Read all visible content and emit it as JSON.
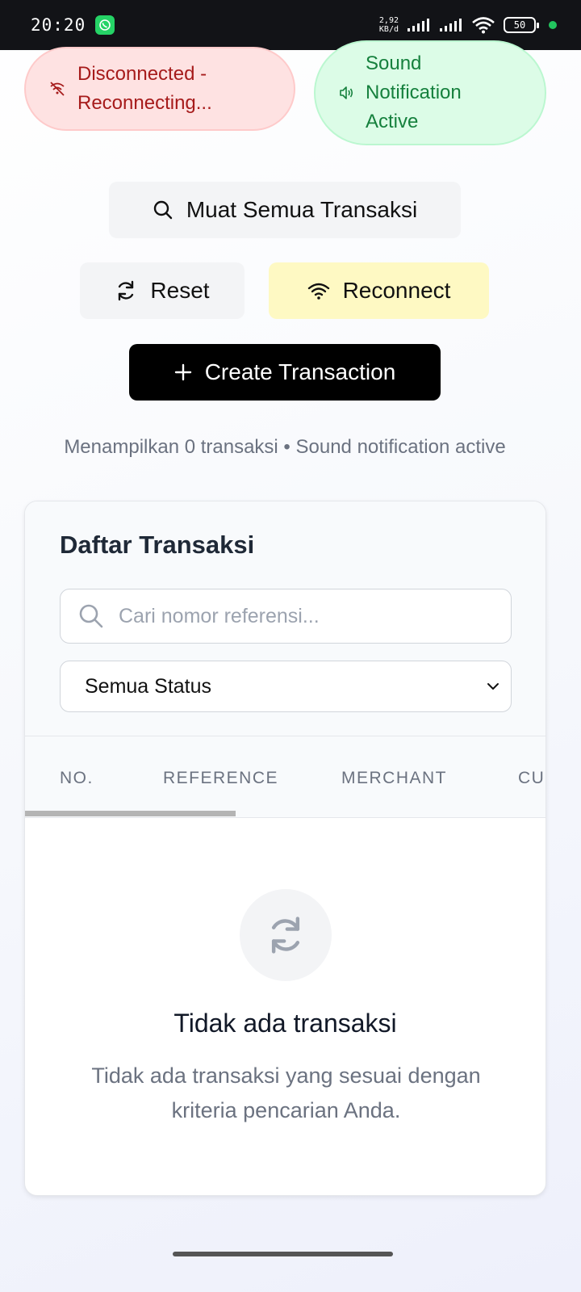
{
  "status_bar": {
    "time": "20:20",
    "net_speed_value": "2,92",
    "net_speed_unit": "KB/d",
    "battery": "50"
  },
  "connection": {
    "label": "Disconnected -\nReconnecting..."
  },
  "sound": {
    "label": "Sound\nNotification\nActive"
  },
  "actions": {
    "load_all": "Muat Semua Transaksi",
    "reset": "Reset",
    "reconnect": "Reconnect",
    "create": "Create Transaction"
  },
  "summary": "Menampilkan 0 transaksi • Sound notification active",
  "table": {
    "title": "Daftar Transaksi",
    "search_placeholder": "Cari nomor referensi...",
    "status_filter": "Semua Status",
    "columns": [
      "NO.",
      "REFERENCE",
      "MERCHANT",
      "CU"
    ]
  },
  "empty_state": {
    "title": "Tidak ada transaksi",
    "description": "Tidak ada transaksi yang sesuai dengan kriteria pencarian Anda."
  },
  "colors": {
    "disconnected_bg": "#fee2e2",
    "disconnected_text": "#a61b1b",
    "sound_bg": "#dcfce7",
    "sound_text": "#15803d",
    "reconnect_bg": "#fef9c3",
    "create_bg": "#000000"
  },
  "icons": {
    "connection": "wifi-off-icon",
    "sound": "speaker-icon",
    "load_all": "search-icon",
    "reset": "refresh-icon",
    "reconnect": "wifi-icon",
    "create": "plus-icon",
    "search": "search-icon",
    "select": "chevron-down-icon",
    "empty": "refresh-icon"
  }
}
